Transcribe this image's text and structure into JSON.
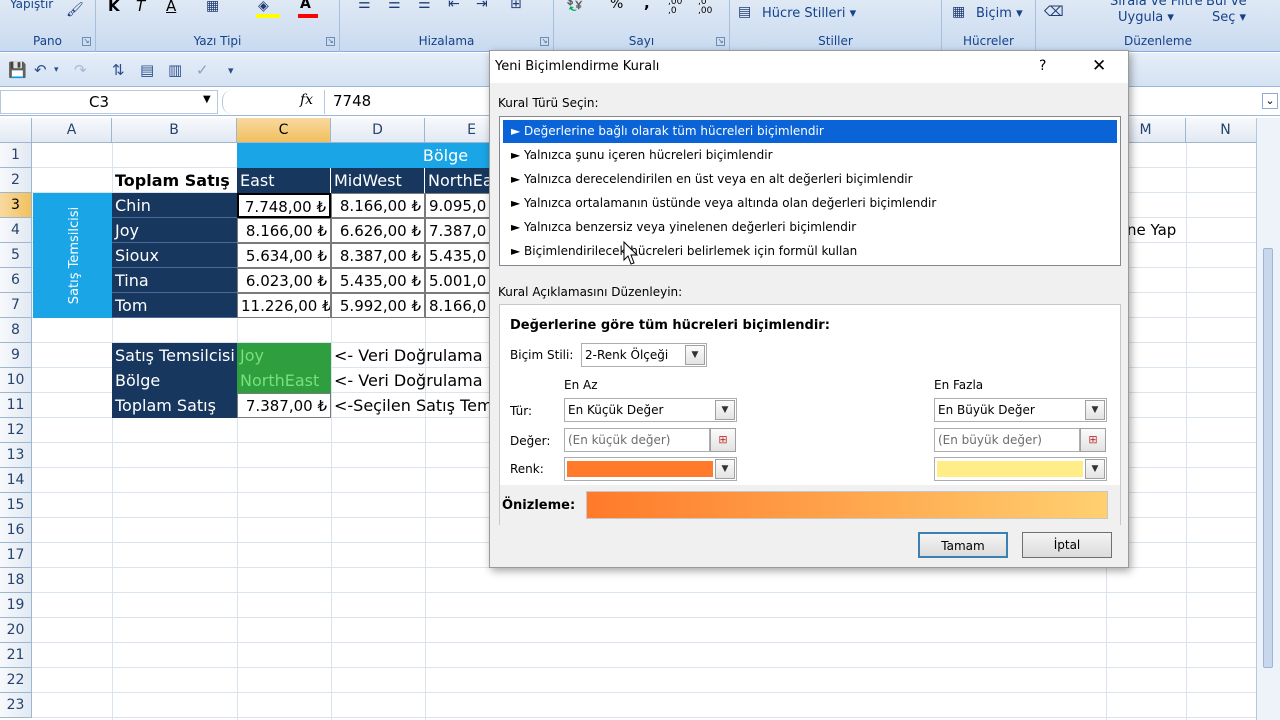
{
  "ribbon": {
    "paste_label": "Yapıştır",
    "groups": [
      "Pano",
      "Yazı Tipi",
      "Hizalama",
      "Sayı",
      "Stiller",
      "Hücreler",
      "Düzenleme"
    ],
    "bold": "K",
    "italic": "T",
    "underline": "A",
    "percent": "%",
    "comma": ",",
    "dec_inc": ",00 ,0",
    "dec_dec": ",0 ,00",
    "cell_styles": "Hücre Stilleri",
    "format": "Biçim",
    "sort_filter_1": "Sırala ve Filtre",
    "sort_filter_2": "Uygula",
    "find_select_1": "Bul ve",
    "find_select_2": "Seç",
    "font_color": "#ff0000",
    "fill_color": "#ffff00"
  },
  "formula_bar": {
    "name_box": "C3",
    "fx": "fx",
    "value": "7748"
  },
  "columns": [
    "A",
    "B",
    "C",
    "D",
    "E",
    "M",
    "N"
  ],
  "rows": [
    "1",
    "2",
    "3",
    "4",
    "5",
    "6",
    "7",
    "8",
    "9",
    "10",
    "11",
    "12",
    "13",
    "14",
    "15",
    "16",
    "17",
    "18",
    "19",
    "20",
    "21",
    "22",
    "23"
  ],
  "sheet": {
    "region_header": "Bölge",
    "total_sales_header": "Toplam Satış",
    "regions": [
      "East",
      "MidWest",
      "NorthEa"
    ],
    "rep_label_vertical": "Satış Temsilcisi",
    "reps": [
      "Chin",
      "Joy",
      "Sioux",
      "Tina",
      "Tom"
    ],
    "values": [
      [
        "7.748,00 ₺",
        "8.166,00 ₺",
        "9.095,0"
      ],
      [
        "8.166,00 ₺",
        "6.626,00 ₺",
        "7.387,0"
      ],
      [
        "5.634,00 ₺",
        "8.387,00 ₺",
        "5.435,0"
      ],
      [
        "6.023,00 ₺",
        "5.435,00 ₺",
        "5.001,0"
      ],
      [
        "11.226,00 ₺",
        "5.992,00 ₺",
        "8.166,0"
      ]
    ],
    "lookup_labels": [
      "Satış Temsilcisi",
      "Bölge",
      "Toplam Satış"
    ],
    "lookup_values": [
      "Joy",
      "NorthEast",
      "7.387,00 ₺"
    ],
    "notes": [
      "<- Veri Doğrulama İle",
      "<- Veri Doğrulama İle",
      "<-Seçilen Satış Temsi"
    ],
    "side_note": "ne Yap"
  },
  "dialog": {
    "title": "Yeni Biçimlendirme Kuralı",
    "help": "?",
    "close": "✕",
    "rule_type_label": "Kural Türü Seçin:",
    "rules": [
      "► Değerlerine bağlı olarak tüm hücreleri biçimlendir",
      "► Yalnızca şunu içeren hücreleri biçimlendir",
      "► Yalnızca derecelendirilen en üst veya en alt değerleri biçimlendir",
      "► Yalnızca ortalamanın üstünde veya altında olan değerleri biçimlendir",
      "► Yalnızca benzersiz veya yinelenen değerleri biçimlendir",
      "► Biçimlendirilecek hücreleri belirlemek için formül kullan"
    ],
    "edit_label": "Kural Açıklamasını Düzenleyin:",
    "desc_title": "Değerlerine göre tüm hücreleri biçimlendir:",
    "format_style_label": "Biçim Stili:",
    "format_style_value": "2-Renk Ölçeği",
    "min_header": "En Az",
    "max_header": "En Fazla",
    "type_label": "Tür:",
    "value_label": "Değer:",
    "color_label": "Renk:",
    "min_type": "En Küçük Değer",
    "max_type": "En Büyük Değer",
    "min_value_placeholder": "(En küçük değer)",
    "max_value_placeholder": "(En büyük değer)",
    "min_color": "#ff7a2a",
    "max_color": "#ffee88",
    "preview_label": "Önizleme:",
    "ok": "Tamam",
    "cancel": "İptal"
  }
}
